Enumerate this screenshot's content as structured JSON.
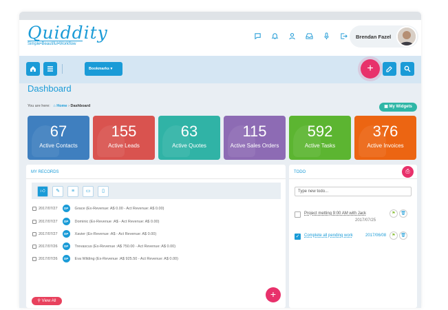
{
  "app": {
    "logo": "Quiddity",
    "tagline": "Simple•Beautiful•Workflow"
  },
  "header": {
    "icons": [
      "chat-icon",
      "bell-icon",
      "user-icon",
      "inbox-icon",
      "microphone-icon",
      "logout-icon"
    ],
    "user_name": "Brendan Fazel"
  },
  "toolbar": {
    "bookmarks_label": "Bookmarks ▾",
    "plus_label": "+"
  },
  "page": {
    "title": "Dashboard"
  },
  "breadcrumb": {
    "prefix": "You are here:",
    "home": "Home",
    "sep": "›",
    "current": "Dashboard"
  },
  "widgets_button": "My Widgets",
  "cards": [
    {
      "value": "67",
      "label": "Active Contacts",
      "color": "#3f7fbf"
    },
    {
      "value": "155",
      "label": "Active Leads",
      "color": "#d9534f"
    },
    {
      "value": "63",
      "label": "Active Quotes",
      "color": "#30b3a6"
    },
    {
      "value": "115",
      "label": "Active Sales Orders",
      "color": "#8d6bb4"
    },
    {
      "value": "592",
      "label": "Active Tasks",
      "color": "#5cb531"
    },
    {
      "value": "376",
      "label": "Active Invoices",
      "color": "#ec6512"
    }
  ],
  "records": {
    "title": "MY RECORDS",
    "op_badge": "OP",
    "items": [
      {
        "date": "2017/07/27",
        "text": "Grace (Ex-Revenue: A$ 0.00  - Act Revenue: A$ 0.00)"
      },
      {
        "date": "2017/07/27",
        "text": "Dominic (Ex-Revenue :A$  - Act Revenue: A$ 0.00)"
      },
      {
        "date": "2017/07/27",
        "text": "Xavier (Ex-Revenue :A$  - Act Revenue: A$ 0.00)"
      },
      {
        "date": "2017/07/26",
        "text": "Trevascus (Ex-Revenue :A$ 750.00  - Act Revenue: A$ 0.00)"
      },
      {
        "date": "2017/07/26",
        "text": "Eva Wilding (Ex-Revenue :A$ 925.50  - Act Revenue: A$ 0.00)"
      }
    ],
    "view_all": "View All"
  },
  "todo": {
    "title": "TODO",
    "placeholder": "Type new todo...",
    "items": [
      {
        "text": "Project metting 9:00 AM with Jack",
        "date": "2017/07/25",
        "done": false
      },
      {
        "text": "Complete all pending work",
        "date": "2017/06/08",
        "done": true
      }
    ]
  }
}
